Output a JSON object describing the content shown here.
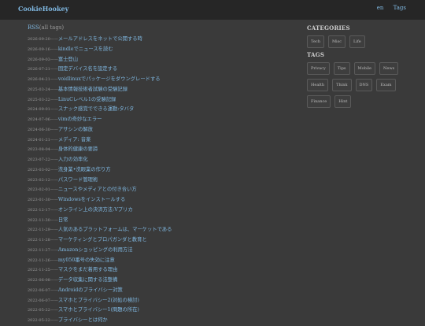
{
  "header": {
    "site_title": "CookieHookey",
    "nav": [
      "en",
      "Tags"
    ]
  },
  "main": {
    "rss_label": "RSS",
    "rss_suffix": "(all tags)",
    "posts": [
      {
        "date": "2026-09-20",
        "title": "メールアドレスをネットで公開する時"
      },
      {
        "date": "2026-09-16",
        "title": "kindleでニュースを読む"
      },
      {
        "date": "2026-09-03",
        "title": "富士登山"
      },
      {
        "date": "2026-07-21",
        "title": "固定デバイス名を設定する"
      },
      {
        "date": "2026-04-21",
        "title": "voidlinuxでパッケージをダウングレードする"
      },
      {
        "date": "2025-03-24",
        "title": "基本情報技術者試験の受験記録"
      },
      {
        "date": "2025-03-22",
        "title": "LinuCレベル1の受験記録"
      },
      {
        "date": "2024-09-01",
        "title": "スナック感覚でできる運動:タバタ"
      },
      {
        "date": "2024-07-06",
        "title": "vimの奇妙なエラー"
      },
      {
        "date": "2024-06-30",
        "title": "アサシンの解放"
      },
      {
        "date": "2024-01-21",
        "title": "メディア: 音楽"
      },
      {
        "date": "2023-08-04",
        "title": "身体的健康の要諦"
      },
      {
        "date": "2023-07-22",
        "title": "入力の効率化"
      },
      {
        "date": "2023-03-02",
        "title": "洗身業•洗眼業の作り方"
      },
      {
        "date": "2023-02-12",
        "title": "パスワード管理術"
      },
      {
        "date": "2023-02-01",
        "title": "ニュースやメディアとの付き合い方"
      },
      {
        "date": "2023-01-30",
        "title": "Windowsをインストールする"
      },
      {
        "date": "2022-12-17",
        "title": "オンライン上の決済方法:Vプリカ"
      },
      {
        "date": "2022-11-30",
        "title": "日常"
      },
      {
        "date": "2022-11-29",
        "title": "人気のあるプラットフォームは、マーケットである"
      },
      {
        "date": "2022-11-28",
        "title": "マーケティングとプロパガンダと教育と"
      },
      {
        "date": "2022-11-27",
        "title": "Amazonショッピングの利用方法"
      },
      {
        "date": "2022-11-26",
        "title": "my050番号の失効に注意"
      },
      {
        "date": "2022-11-25",
        "title": "マスクをまだ着用する理由"
      },
      {
        "date": "2022-06-08",
        "title": "データ収集に関する法整備"
      },
      {
        "date": "2022-06-07",
        "title": "Androidのプライバシー対策"
      },
      {
        "date": "2022-06-07",
        "title": "スマホとプライバシー2(対処の検討)"
      },
      {
        "date": "2022-05-22",
        "title": "スマホとプライバシー1(問題の所在)"
      },
      {
        "date": "2022-05-22",
        "title": "プライバシーとは何か"
      }
    ]
  },
  "sidebar": {
    "categories_heading": "CATEGORIES",
    "categories": [
      "Tech",
      "Misc",
      "Life"
    ],
    "tags_heading": "TAGS",
    "tags": [
      "Privacy",
      "Tips",
      "Mobile",
      "News",
      "Health",
      "Think",
      "DNS",
      "Exam",
      "Finance",
      "Hint"
    ]
  },
  "colors": {
    "background": "#3a3a3a",
    "topbar": "#262626",
    "link": "#7fb7e0",
    "muted": "#9a9a9a"
  }
}
